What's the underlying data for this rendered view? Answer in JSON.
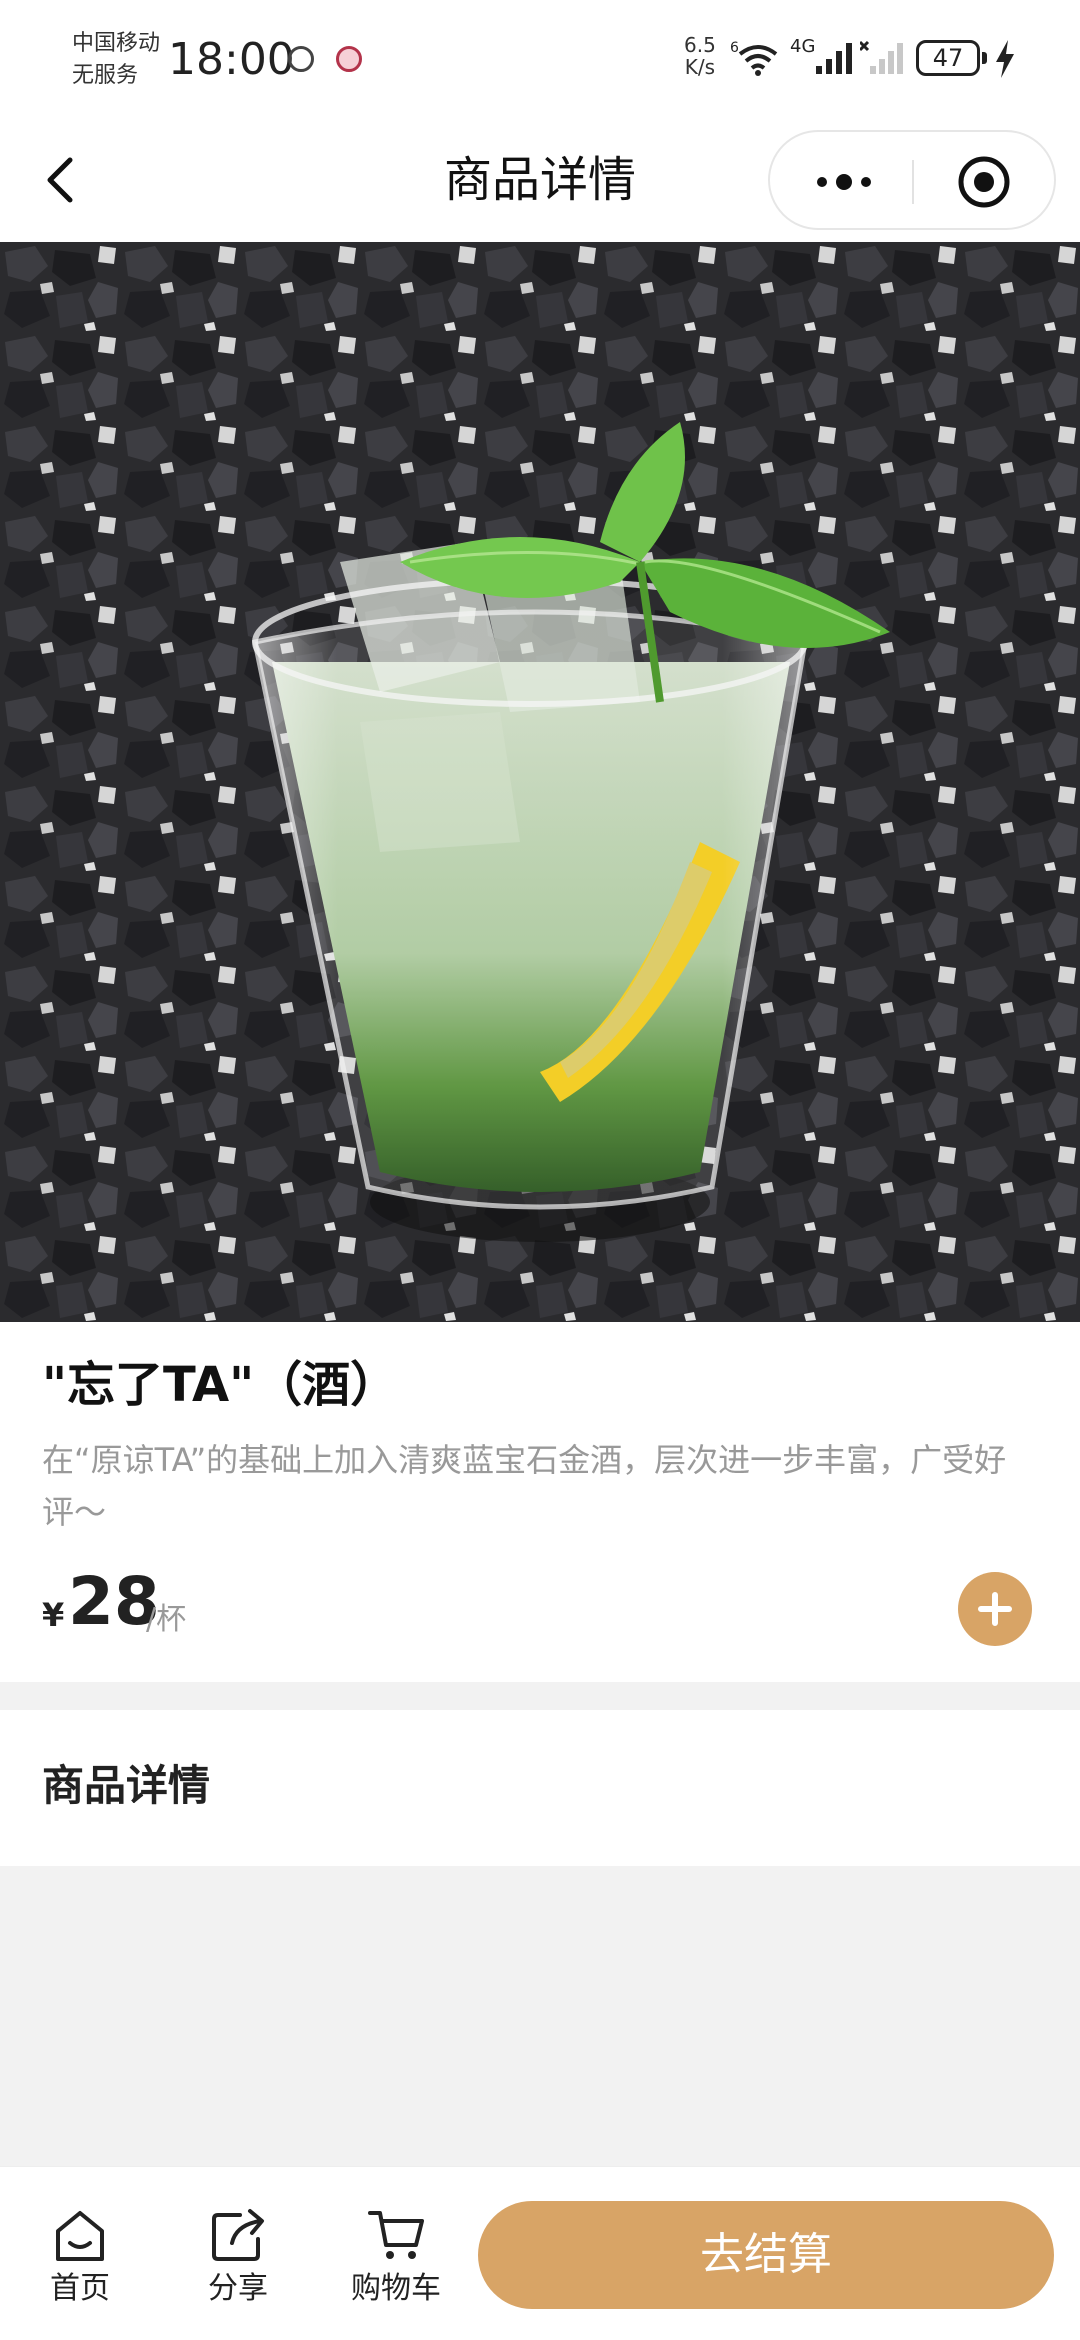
{
  "status_bar": {
    "carrier": "中国移动",
    "carrier_status": "无服务",
    "time": "18:00",
    "net_speed_value": "6.5",
    "net_speed_unit": "K/s",
    "wifi_badge": "6",
    "network_type": "4G",
    "battery": "47"
  },
  "nav": {
    "title": "商品详情"
  },
  "product": {
    "image_icon": "mint-lemon-drink-photo",
    "name": "\"忘了TA\"（酒）",
    "description": "在“原谅TA”的基础上加入清爽蓝宝石金酒，层次进一步丰富，广受好评～",
    "currency": "¥",
    "price": "28",
    "unit": "/杯"
  },
  "details": {
    "heading": "商品详情"
  },
  "bottom_bar": {
    "tabs": [
      {
        "label": "首页",
        "icon": "home-icon"
      },
      {
        "label": "分享",
        "icon": "share-icon"
      },
      {
        "label": "购物车",
        "icon": "cart-icon"
      }
    ],
    "checkout_label": "去结算"
  },
  "colors": {
    "accent": "#d8a466",
    "page_background": "#f2f2f2",
    "muted_text": "#999999"
  }
}
